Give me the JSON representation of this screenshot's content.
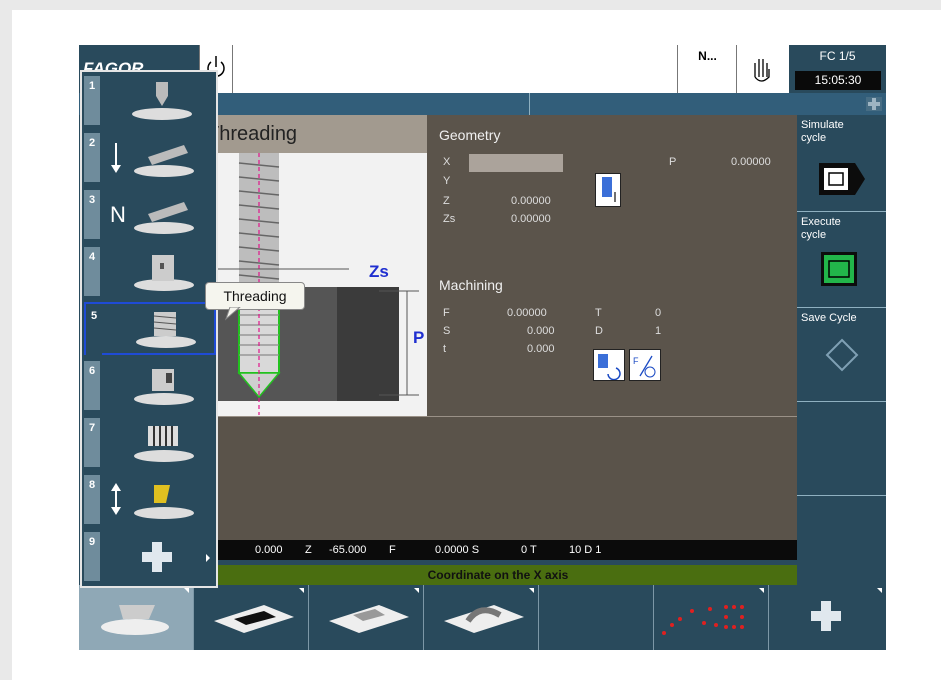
{
  "topbar": {
    "logo": "FAGOR",
    "program": "N...",
    "fc": "FC 1/5",
    "clock": "15:05:30"
  },
  "cycle": {
    "title": "Threading",
    "label_zs": "Zs",
    "label_p": "P"
  },
  "geometry": {
    "header": "Geometry",
    "x_label": "X",
    "x_value": "",
    "y_label": "Y",
    "z_label": "Z",
    "z_value": "0.00000",
    "zs_label": "Zs",
    "zs_value": "0.00000",
    "p_label": "P",
    "p_value": "0.00000"
  },
  "machining": {
    "header": "Machining",
    "f_label": "F",
    "f_value": "0.00000",
    "s_label": "S",
    "s_value": "0.000",
    "t_label": "t",
    "t_value": "0.000",
    "T_label": "T",
    "T_value": "0",
    "D_label": "D",
    "D_value": "1"
  },
  "coordbar": {
    "x_val": "0.000",
    "z_label": "Z",
    "z_val": "-65.000",
    "f_label": "F",
    "f_val": "0.0000 S",
    "s_val": "0 T",
    "t_val": "10 D 1"
  },
  "status": "Coordinate on the X axis",
  "softkeys": [
    {
      "label": "Simulate cycle"
    },
    {
      "label": "Execute cycle"
    },
    {
      "label": "Save Cycle"
    },
    {
      "label": ""
    },
    {
      "label": ""
    }
  ],
  "menu": {
    "items": [
      "1",
      "2",
      "3",
      "4",
      "5",
      "6",
      "7",
      "8",
      "9"
    ],
    "selected": "5",
    "tooltip": "Threading"
  },
  "colors": {
    "panel": "#294a5c",
    "selection": "#1f4bd6",
    "param_bg": "#5b544b",
    "status_bg": "#4a6e10"
  }
}
